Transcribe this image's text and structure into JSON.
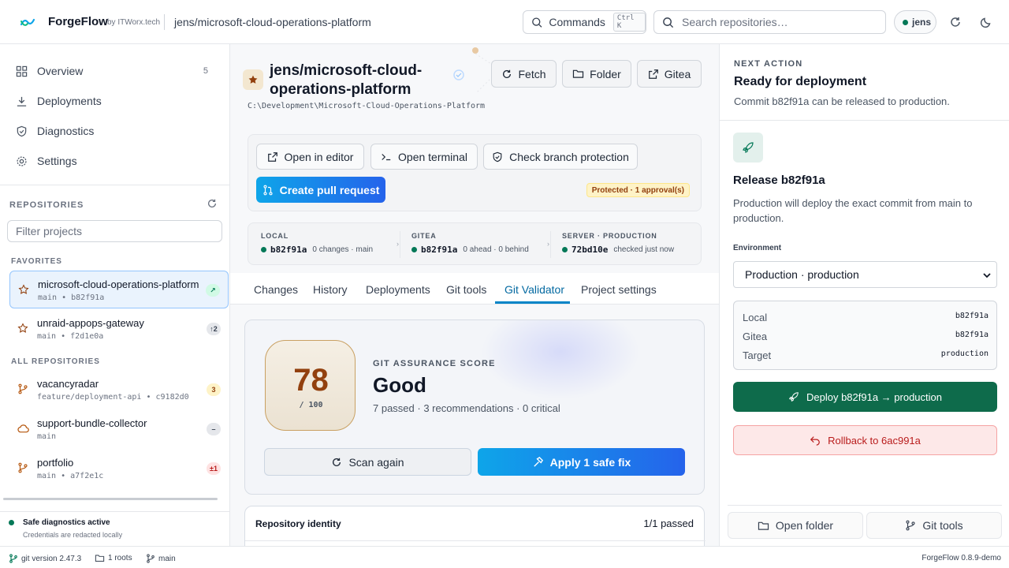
{
  "app": {
    "brand": "ForgeFlow",
    "by": "by ITWorx.tech",
    "current_repo": "jens/microsoft-cloud-operations-platform",
    "commands_label": "Commands",
    "commands_shortcut": "Ctrl K",
    "search_placeholder": "Search repositories…",
    "user": "jens",
    "accent": "#0284c7",
    "brand_color": "#0ea5e9"
  },
  "sidebar": {
    "nav": [
      {
        "label": "Overview",
        "count": "5",
        "icon": "grid-icon"
      },
      {
        "label": "Deployments",
        "count": "",
        "icon": "download-icon"
      },
      {
        "label": "Diagnostics",
        "count": "",
        "icon": "shield-icon"
      },
      {
        "label": "Settings",
        "count": "",
        "icon": "gear-icon"
      }
    ],
    "repositories_title": "REPOSITORIES",
    "filter_placeholder": "Filter projects",
    "favorites_title": "FAVORITES",
    "all_title": "ALL REPOSITORIES",
    "favorites": [
      {
        "name": "microsoft-cloud-operations-platform",
        "meta": "main • b82f91a",
        "badge": "↗",
        "active": true
      },
      {
        "name": "unraid-appops-gateway",
        "meta": "main • f2d1e0a",
        "badge": "↑2"
      }
    ],
    "all": [
      {
        "name": "vacancyradar",
        "meta": "feature/deployment-api • c9182d0",
        "badge": "3"
      },
      {
        "name": "support-bundle-collector",
        "meta": "main",
        "badge": "–"
      },
      {
        "name": "portfolio",
        "meta": "main • a7f2e1c",
        "badge": "±1"
      }
    ],
    "safe_title": "Safe diagnostics active",
    "safe_sub": "Credentials are redacted locally"
  },
  "statusbar": {
    "git_version": "git version 2.47.3",
    "roots": "1 roots",
    "branch": "main",
    "version": "ForgeFlow 0.8.9-demo"
  },
  "main": {
    "title": "jens/microsoft-cloud-operations-platform",
    "path": "C:\\Development\\Microsoft-Cloud-Operations-Platform",
    "header_buttons": {
      "fetch": "Fetch",
      "folder": "Folder",
      "gitea": "Gitea"
    },
    "actions": {
      "open_editor": "Open in editor",
      "open_terminal": "Open terminal",
      "check_protection": "Check branch protection",
      "create_pr": "Create pull request",
      "protected": "Protected · 1 approval(s)"
    },
    "envs": [
      {
        "label": "LOCAL",
        "sha": "b82f91a",
        "detail": "0 changes · main"
      },
      {
        "label": "GITEA",
        "sha": "b82f91a",
        "detail": "0 ahead · 0 behind"
      },
      {
        "label": "SERVER · PRODUCTION",
        "sha": "72bd10e",
        "detail": "checked just now"
      }
    ],
    "tabs": [
      "Changes",
      "History",
      "Deployments",
      "Git tools",
      "Git Validator",
      "Project settings"
    ],
    "active_tab": "Git Validator",
    "score": {
      "value": "78",
      "out_of": "/ 100",
      "label": "GIT ASSURANCE SCORE",
      "grade": "Good",
      "summary": "7 passed · 3 recommendations · 0 critical",
      "scan_again": "Scan again",
      "apply_fix": "Apply 1 safe fix"
    },
    "identity": {
      "title": "Repository identity",
      "count": "1/1 passed"
    }
  },
  "right": {
    "next_action_label": "NEXT ACTION",
    "title": "Ready for deployment",
    "subtitle": "Commit b82f91a can be released to production.",
    "release_title": "Release b82f91a",
    "release_desc": "Production will deploy the exact commit from main to production.",
    "env_label": "Environment",
    "env_value": "Production · production",
    "kv": [
      {
        "k": "Local",
        "v": "b82f91a"
      },
      {
        "k": "Gitea",
        "v": "b82f91a"
      },
      {
        "k": "Target",
        "v": "production"
      }
    ],
    "deploy": "Deploy b82f91a → production",
    "rollback": "Rollback to 6ac991a",
    "open_folder": "Open folder",
    "git_tools": "Git tools"
  }
}
